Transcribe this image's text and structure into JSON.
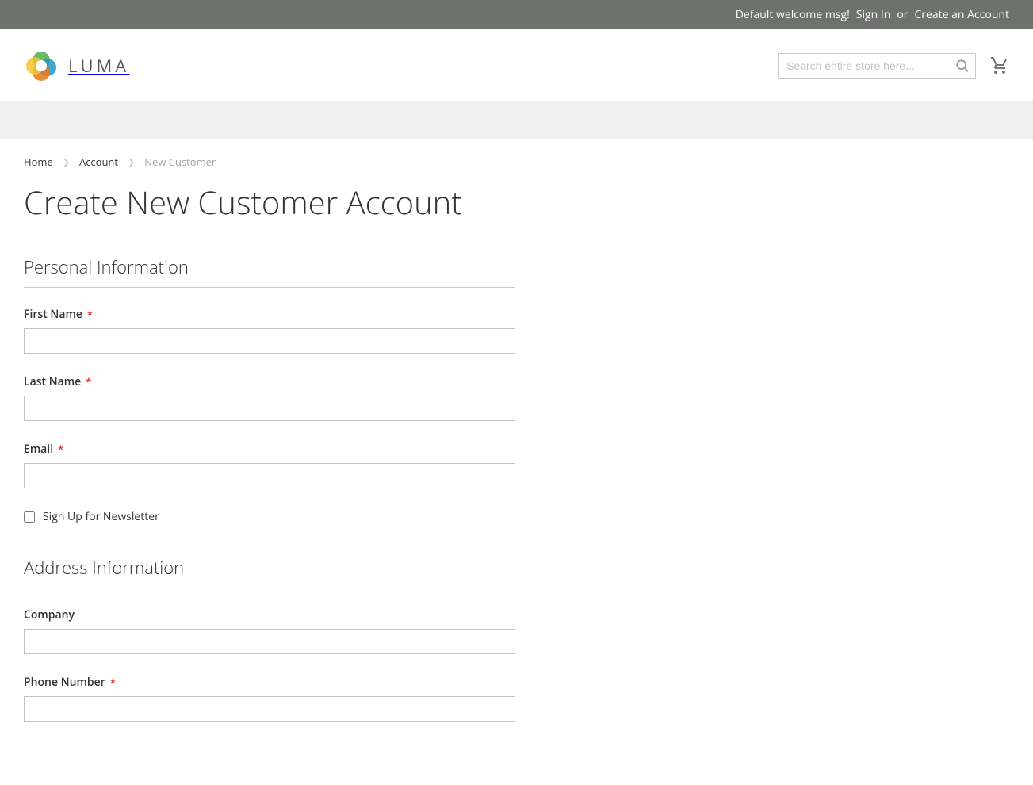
{
  "top_banner": {
    "welcome": "Default welcome msg!",
    "sign_in": "Sign In",
    "or": "or",
    "create_account": "Create an Account"
  },
  "header": {
    "logo_text": "LUMA",
    "search_placeholder": "Search entire store here..."
  },
  "breadcrumbs": {
    "home": "Home",
    "account": "Account",
    "current": "New Customer"
  },
  "page_title": "Create New Customer Account",
  "sections": {
    "personal": {
      "heading": "Personal Information",
      "first_name_label": "First Name",
      "last_name_label": "Last Name",
      "email_label": "Email",
      "newsletter_label": "Sign Up for Newsletter"
    },
    "address": {
      "heading": "Address Information",
      "company_label": "Company",
      "phone_label": "Phone Number"
    }
  }
}
